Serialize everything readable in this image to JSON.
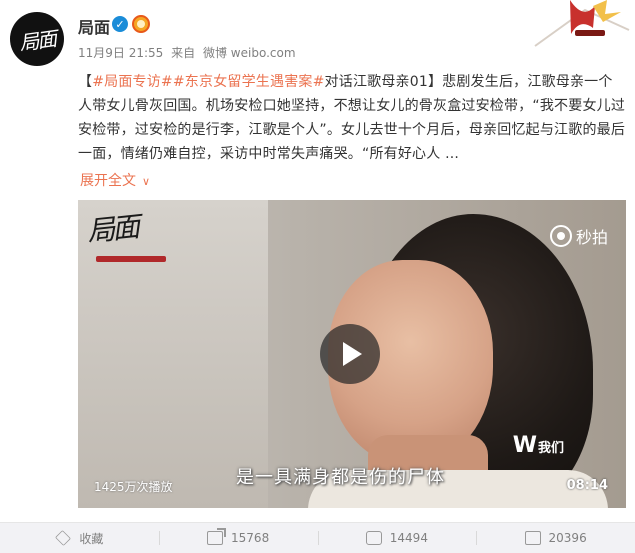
{
  "user": {
    "name": "局面",
    "avatar_text": "局面",
    "verified": true
  },
  "meta": {
    "time": "11月9日 21:55",
    "from_label": "来自",
    "source": "微博 weibo.com"
  },
  "post": {
    "bracket_open": "【",
    "hashtag1": "#局面专访#",
    "hashtag2": "#东京女留学生遇害案#",
    "text_part1": "对话江歌母亲01】悲剧发生后，江歌母亲一个人带女儿骨灰回国。机场安检口她坚持，不想让女儿的骨灰盒过安检带，“我不要女儿过安检带，过安检的是行李，江歌是个人”。女儿去世十个月后，母亲回忆起与江歌的最后一面，情绪仍难自控，采访中时常失声痛哭。“所有好心人 ...",
    "expand_label": "展开全文"
  },
  "video": {
    "logo_text": "局面",
    "platform": "秒拍",
    "watermark": "我们",
    "subtitle": "是一具满身都是伤的尸体",
    "views": "1425万次播放",
    "duration": "08:14"
  },
  "actions": {
    "favorite": "收藏",
    "share": "15768",
    "comment": "14494",
    "like": "20396"
  },
  "colors": {
    "link": "#eb7350",
    "footer_bg": "#f2f2f5",
    "verified": "#1a8cd8"
  }
}
